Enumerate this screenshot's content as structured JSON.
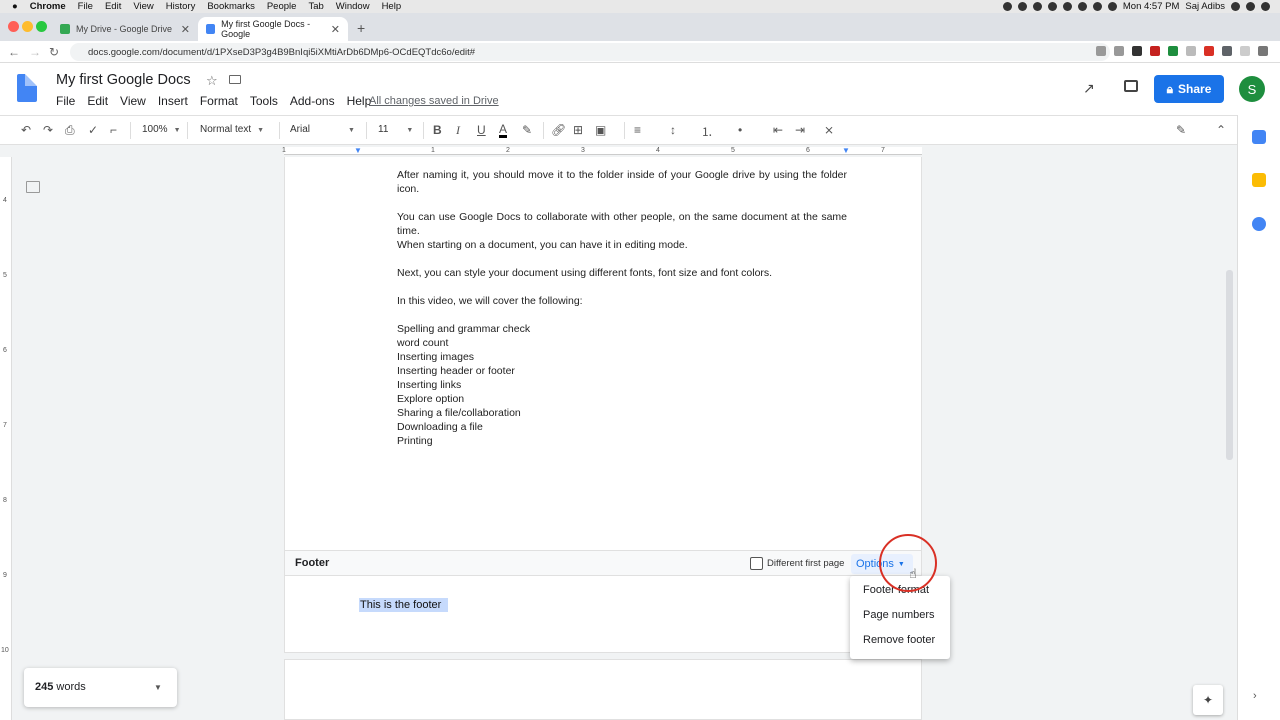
{
  "macbar": {
    "app": "Chrome",
    "menus": [
      "File",
      "Edit",
      "View",
      "History",
      "Bookmarks",
      "People",
      "Tab",
      "Window",
      "Help"
    ],
    "clock": "Mon 4:57 PM",
    "user": "Saj Adibs"
  },
  "browser": {
    "tabs": [
      {
        "label": "My Drive - Google Drive",
        "active": false
      },
      {
        "label": "My first Google Docs - Google",
        "active": true
      }
    ],
    "new_tab": "+",
    "url": "docs.google.com/document/d/1PXseD3P3g4B9BnIqi5iXMtiArDb6DMp6-OCdEQTdc6o/edit#"
  },
  "docs": {
    "title": "My first Google Docs",
    "menus": [
      "File",
      "Edit",
      "View",
      "Insert",
      "Format",
      "Tools",
      "Add-ons",
      "Help"
    ],
    "save_status": "All changes saved in Drive",
    "share_label": "Share",
    "avatar_initial": "S"
  },
  "toolbar": {
    "zoom": "100%",
    "style": "Normal text",
    "font": "Arial",
    "size": "11",
    "bold": "B",
    "italic": "I",
    "underline": "U",
    "text_color": "A"
  },
  "ruler": {
    "h_marks": [
      "1",
      "1",
      "2",
      "3",
      "4",
      "5",
      "6",
      "7"
    ],
    "v_marks": [
      "4",
      "5",
      "6",
      "7",
      "8",
      "9",
      "10"
    ]
  },
  "document": {
    "paragraphs": [
      "After naming it, you should move it to the folder inside of your Google drive by using the folder icon.",
      "You can use Google Docs to collaborate with other people, on the same document at the same time.",
      "When starting on a document, you can have it in editing mode.",
      "Next, you can style your document using different fonts, font size and font colors.",
      "In this video, we will cover the following:"
    ],
    "list": [
      "Spelling and grammar check",
      "word count",
      "Inserting images",
      "Inserting header or footer",
      "Inserting links",
      "Explore option",
      "Sharing a file/collaboration",
      "Downloading a file",
      "Printing"
    ]
  },
  "footer": {
    "label": "Footer",
    "different_first_page": "Different first page",
    "options_label": "Options",
    "text": "This is the footer",
    "menu": [
      "Footer format",
      "Page numbers",
      "Remove footer"
    ]
  },
  "word_count": {
    "count": "245",
    "unit": "words"
  },
  "colors": {
    "accent": "#1a73e8",
    "avatar": "#1e8e3e",
    "highlight": "#c6dafc",
    "click_ring": "#d93025"
  }
}
